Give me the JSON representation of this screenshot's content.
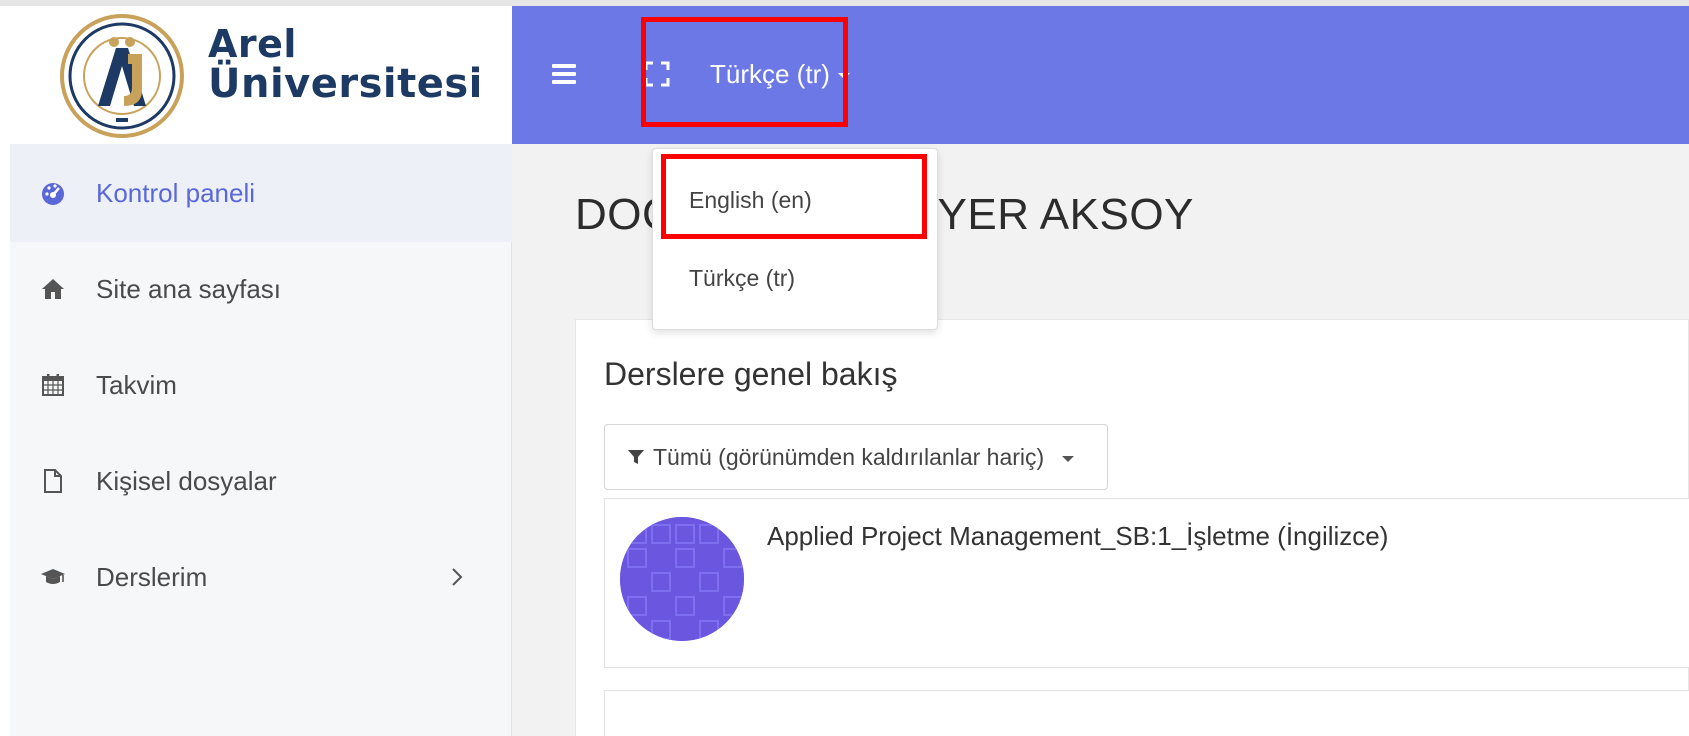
{
  "brand": {
    "line1": "Arel",
    "line2": "Üniversitesi"
  },
  "header": {
    "language_label": "Türkçe (tr)"
  },
  "language_menu": {
    "items": [
      {
        "label": "English (en)"
      },
      {
        "label": "Türkçe (tr)"
      }
    ]
  },
  "sidebar": {
    "items": [
      {
        "label": "Kontrol paneli",
        "icon": "dashboard-icon"
      },
      {
        "label": "Site ana sayfası",
        "icon": "home-icon"
      },
      {
        "label": "Takvim",
        "icon": "calendar-icon"
      },
      {
        "label": "Kişisel dosyalar",
        "icon": "file-icon"
      },
      {
        "label": "Derslerim",
        "icon": "graduation-cap-icon"
      }
    ]
  },
  "main": {
    "page_title": "DOÇ. D              ZYER AKSOY",
    "overview_title": "Derslere genel bakış",
    "filter_label": "Tümü (görünümden kaldırılanlar hariç)",
    "courses": [
      {
        "name": "Applied Project Management_SB:1_İşletme (İngilizce)"
      }
    ]
  },
  "colors": {
    "navbar": "#6b78e5",
    "highlight": "#ff0000",
    "brand_text": "#1c3a63",
    "sidebar_active_text": "#5a67d8",
    "course_image": "#6b56e0"
  }
}
